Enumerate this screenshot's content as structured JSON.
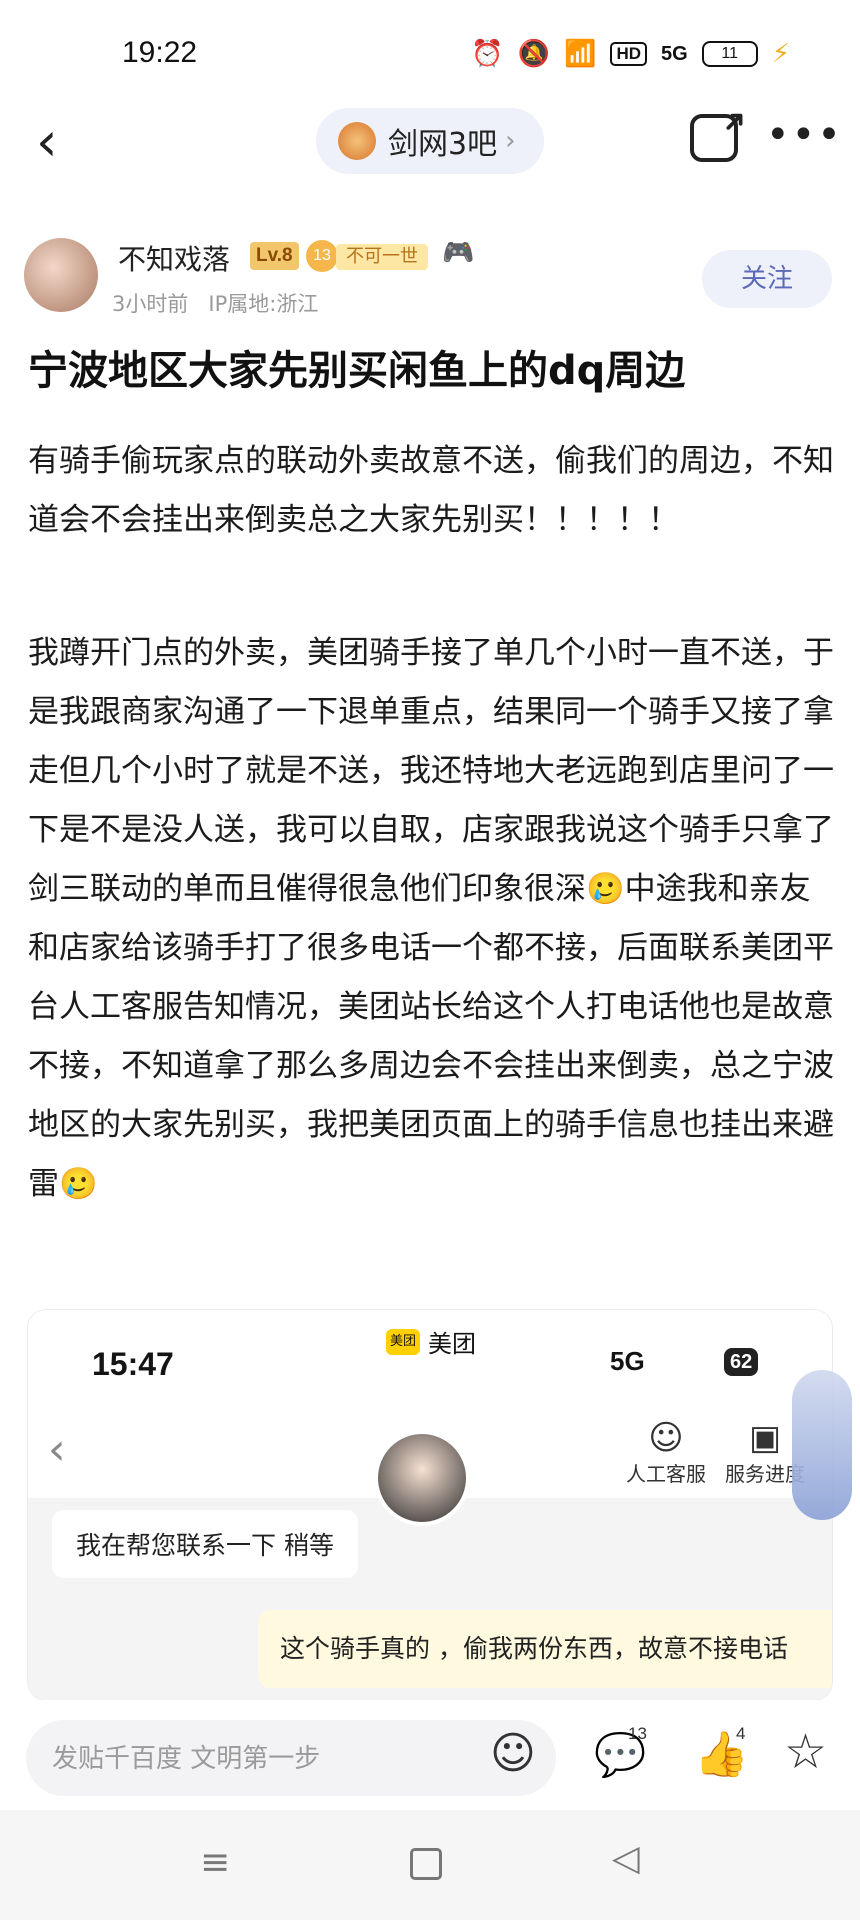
{
  "status_bar": {
    "time": "19:22",
    "icons": [
      "alarm-icon",
      "mute-icon",
      "wifi-icon"
    ],
    "hd": "HD",
    "network": "5G",
    "battery": "11"
  },
  "nav": {
    "forum_name": "剑网3吧",
    "back_icon": "chevron-left-icon",
    "share_icon": "share-icon",
    "more_icon": "more-icon"
  },
  "author": {
    "name": "不知戏落",
    "level": "Lv.8",
    "badge_number": "13",
    "title_tag": "不可一世",
    "time": "3小时前",
    "ip": "IP属地:浙江",
    "follow_label": "关注"
  },
  "post": {
    "title": "宁波地区大家先别买闲鱼上的dq周边",
    "paragraph1": "有骑手偷玩家点的联动外卖故意不送，偷我们的周边，不知道会不会挂出来倒卖总之大家先别买！！！！！",
    "paragraph2": "我蹲开门点的外卖，美团骑手接了单几个小时一直不送，于是我跟商家沟通了一下退单重点，结果同一个骑手又接了拿走但几个小时了就是不送，我还特地大老远跑到店里问了一下是不是没人送，我可以自取，店家跟我说这个骑手只拿了剑三联动的单而且催得很急他们印象很深🥲中途我和亲友和店家给该骑手打了很多电话一个都不接，后面联系美团平台人工客服告知情况，美团站长给这个人打电话他也是故意不接，不知道拿了那么多周边会不会挂出来倒卖，总之宁波地区的大家先别买，我把美团页面上的骑手信息也挂出来避雷🥲"
  },
  "embedded": {
    "time": "15:47",
    "app_logo": "美团",
    "app_name": "美团",
    "network": "5G",
    "battery": "62",
    "service1": "人工客服",
    "service2": "服务进度",
    "msg_left": "我在帮您联系一下 稍等",
    "msg_right": "这个骑手真的 ，偷我两份东西，故意不接电话"
  },
  "bottom_bar": {
    "input_placeholder": "发贴千百度 文明第一步",
    "comment_count": "13",
    "like_count": "4"
  }
}
